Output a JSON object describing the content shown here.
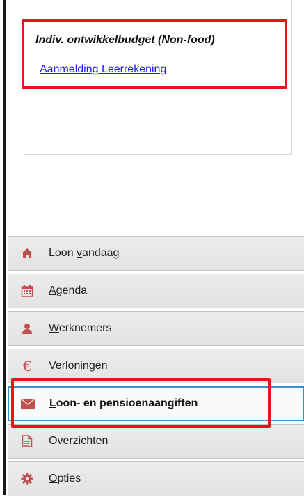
{
  "panel": {
    "heading": "Indiv. ontwikkelbudget (Non-food)",
    "link": "Aanmelding Leerrekening"
  },
  "nav": {
    "items": [
      {
        "icon": "home-icon",
        "pre": "Loon ",
        "ul": "v",
        "post": "andaag",
        "active": false
      },
      {
        "icon": "calendar-icon",
        "pre": "",
        "ul": "A",
        "post": "genda",
        "active": false
      },
      {
        "icon": "user-icon",
        "pre": "",
        "ul": "W",
        "post": "erknemers",
        "active": false
      },
      {
        "icon": "euro-icon",
        "pre": "",
        "ul": "",
        "post": "Verloningen",
        "active": false
      },
      {
        "icon": "envelope-icon",
        "pre": "",
        "ul": "L",
        "post": "oon- en pensioenaangiften",
        "active": true
      },
      {
        "icon": "document-icon",
        "pre": "",
        "ul": "O",
        "post": "verzichten",
        "active": false
      },
      {
        "icon": "gear-icon",
        "pre": "",
        "ul": "O",
        "post": "pties",
        "active": false
      }
    ]
  },
  "colors": {
    "highlight": "#e8141b",
    "active_border": "#3a8cd0",
    "icon": "#c0504d",
    "link": "#1a1aff"
  }
}
